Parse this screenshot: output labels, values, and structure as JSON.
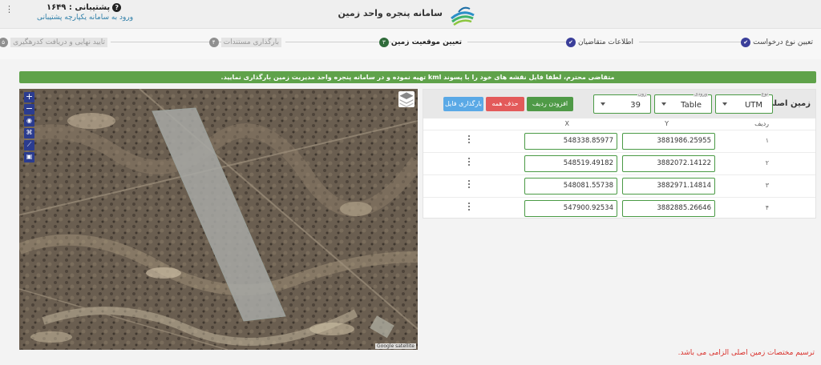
{
  "header": {
    "app_title": "سامانه پنجره واحد زمین",
    "support_label": "پشتیبانی : ۱۶۴۹",
    "support_link": "ورود به سامانه یکپارچه پشتیبانی"
  },
  "stepper": {
    "steps": [
      {
        "label": "تعیین نوع درخواست",
        "state": "done"
      },
      {
        "label": "اطلاعات متقاضیان",
        "state": "done"
      },
      {
        "label": "تعیین موقعیت زمین",
        "state": "active",
        "number": "۳"
      },
      {
        "label": "بارگذاری مستندات",
        "state": "pending",
        "number": "۴"
      },
      {
        "label": "تایید نهایی و دریافت کدرهگیری",
        "state": "pending",
        "number": "۵"
      }
    ]
  },
  "alert": {
    "text": "متقاضی محترم، لطفا فایل نقشه های خود را با پسوند kml تهیه نموده و در سامانه پنجره واحد مدیریت زمین بارگذاری نمایید."
  },
  "map": {
    "attribution": "Google satellite",
    "controls": [
      "zoom-in",
      "zoom-out",
      "locate",
      "measure",
      "draw-line",
      "select-box"
    ],
    "zoom_in_label": "+",
    "zoom_out_label": "−"
  },
  "panel": {
    "title": "زمین اصلی:",
    "selects": {
      "type": {
        "legend": "نوع",
        "value": "UTM"
      },
      "input": {
        "legend": "ورودی",
        "value": "Table"
      },
      "zone": {
        "legend": "زون",
        "value": "39"
      }
    },
    "buttons": {
      "add_row": "افزودن ردیف",
      "delete_all": "حذف همه",
      "upload_file": "بارگذاری فایل"
    },
    "columns": {
      "row": "ردیف",
      "y": "Y",
      "x": "X"
    },
    "rows": [
      {
        "idx": "۱",
        "y": "3881986.25955",
        "x": "548338.85977"
      },
      {
        "idx": "۲",
        "y": "3882072.14122",
        "x": "548519.49182"
      },
      {
        "idx": "۳",
        "y": "3882971.14814",
        "x": "548081.55738"
      },
      {
        "idx": "۴",
        "y": "3882885.26646",
        "x": "547900.92534"
      }
    ]
  },
  "error_note": "ترسیم مختصات زمین اصلی الزامی می باشد.",
  "colors": {
    "primary": "#3b3f9a",
    "success": "#5fa24a",
    "danger": "#e35a5a",
    "info": "#5aa9e6",
    "error_text": "#d9302b"
  }
}
